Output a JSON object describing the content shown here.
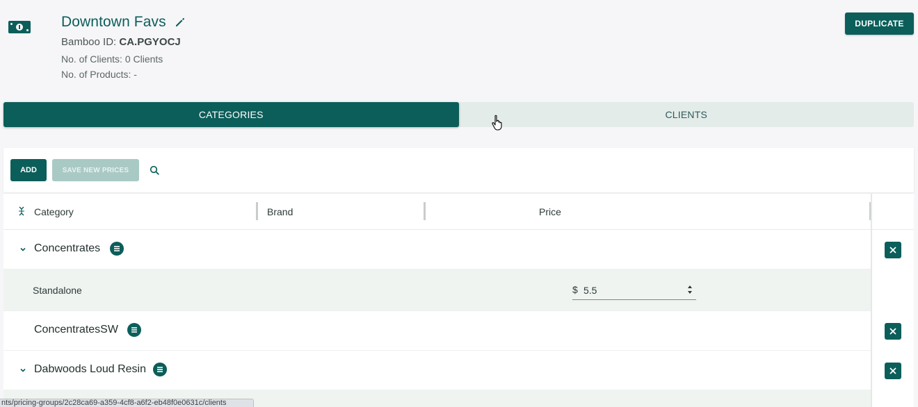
{
  "header": {
    "title": "Downtown Favs",
    "bamboo_label": "Bamboo ID:",
    "bamboo_id": "CA.PGYOCJ",
    "clients_line": "No. of Clients: 0 Clients",
    "products_line": "No. of Products: -",
    "duplicate_label": "DUPLICATE"
  },
  "tabs": [
    {
      "label": "CATEGORIES",
      "active": true
    },
    {
      "label": "CLIENTS",
      "active": false
    }
  ],
  "toolbar": {
    "add_label": "ADD",
    "save_label": "SAVE NEW PRICES"
  },
  "table": {
    "columns": [
      "Category",
      "Brand",
      "Price"
    ],
    "rows": [
      {
        "type": "category",
        "name": "Concentrates",
        "expanded": true
      },
      {
        "type": "item",
        "name": "Standalone",
        "currency": "$",
        "price": "5.5"
      },
      {
        "type": "category",
        "name": "ConcentratesSW",
        "expanded": false
      },
      {
        "type": "category",
        "name": "Dabwoods Loud Resin",
        "expanded": true
      }
    ]
  },
  "status_bar": {
    "url": "nts/pricing-groups/2c28ca69-a359-4cf8-a6f2-eb48f0e0631c/clients"
  },
  "colors": {
    "primary": "#0c5e5a",
    "tab_inactive_bg": "#e3ece9",
    "disabled_btn": "#a9c9c5",
    "sub_row_bg": "#f0f4f1",
    "page_bg": "#f6f6f9"
  },
  "icons": [
    "money-icon",
    "pencil-icon",
    "search-icon",
    "unfold-icon",
    "chevron-down-icon",
    "menu-lines-icon",
    "close-icon",
    "hand-cursor-icon"
  ]
}
